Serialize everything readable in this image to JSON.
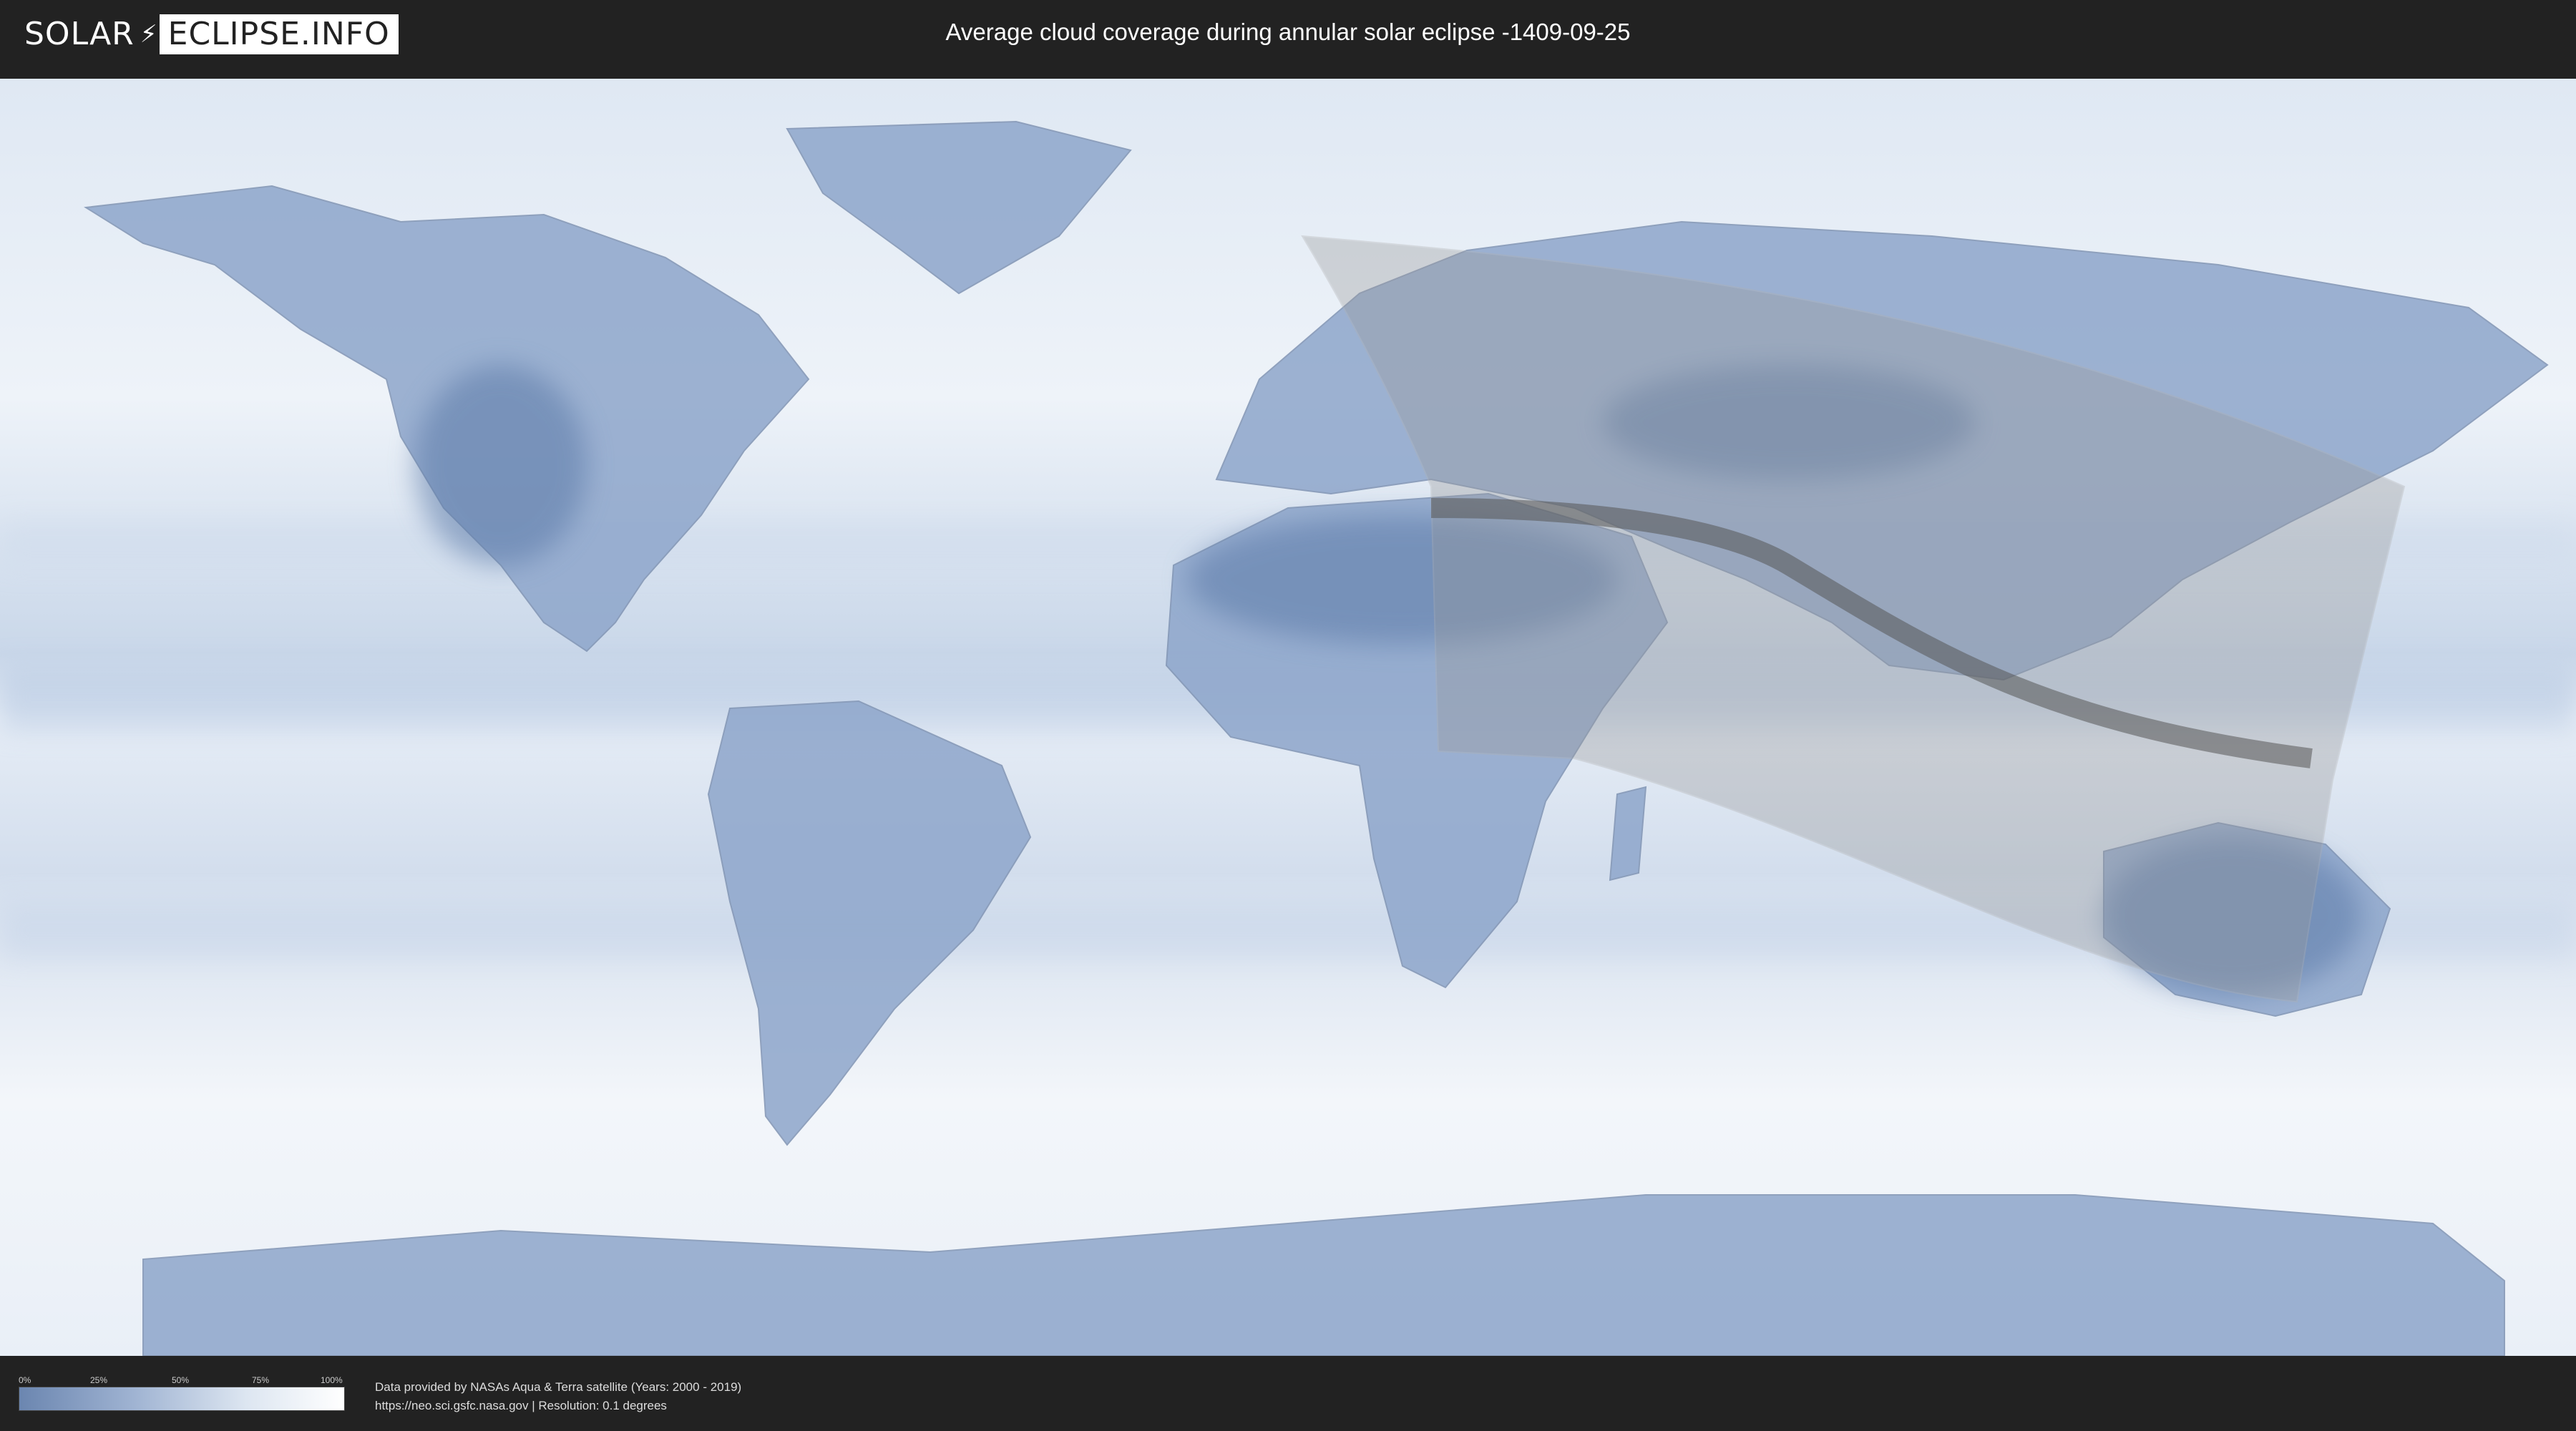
{
  "header": {
    "logo_left": "SOLAR",
    "logo_right": "ECLIPSE.INFO",
    "title": "Average cloud coverage during annular solar eclipse -1409-09-25"
  },
  "legend": {
    "ticks": [
      "0%",
      "25%",
      "50%",
      "75%",
      "100%"
    ],
    "colors": [
      "#6b86b0",
      "#ffffff"
    ]
  },
  "credits": {
    "line1": "Data provided by NASAs Aqua & Terra satellite (Years: 2000 - 2019)",
    "line2": "https://neo.sci.gsfc.nasa.gov | Resolution: 0.1 degrees"
  },
  "map_colors": {
    "cloud": "#eef3f9",
    "clear_sky": "#6f8cb6",
    "shadow_band": "#9a9a9a",
    "central_path": "#555555"
  }
}
